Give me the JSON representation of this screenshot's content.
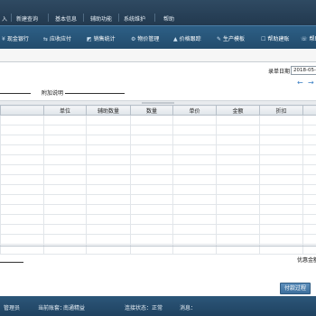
{
  "menubar": {
    "items": [
      "入",
      "新建查询",
      "基本信息",
      "辅助功能",
      "系统维护",
      "帮助"
    ]
  },
  "toolbar": {
    "items": [
      {
        "icon": "yen-icon",
        "glyph": "¥",
        "label": "现金银行"
      },
      {
        "icon": "exchange-icon",
        "glyph": "⇆",
        "label": "应收应付"
      },
      {
        "icon": "chart-icon",
        "glyph": "◩",
        "label": "销售统计"
      },
      {
        "icon": "gear-icon",
        "glyph": "⚙",
        "label": "物价管理"
      },
      {
        "icon": "price-icon",
        "glyph": "▲",
        "label": "价格跟踪"
      },
      {
        "icon": "wrench-icon",
        "glyph": "✎",
        "label": "生产模板"
      },
      {
        "icon": "help-icon",
        "glyph": "☐",
        "label": "帮助建账"
      },
      {
        "icon": "phone-icon",
        "glyph": "☏",
        "label": "帮助"
      }
    ]
  },
  "form": {
    "date_label": "录单日期",
    "date_value": "2018-05-2",
    "note_label": "附加说明",
    "prev_arrow": "←",
    "next_arrow": "→"
  },
  "table": {
    "headers": [
      "",
      "单位",
      "辅助数量",
      "数量",
      "单价",
      "金额",
      "折扣",
      ""
    ]
  },
  "footer": {
    "discount_label": "优惠金额",
    "process_button": "付款过程"
  },
  "status": {
    "operator": "管理员",
    "account_label": "当前账套：",
    "account_value": "南通精益",
    "connection": "连接状态：正常",
    "message": "消息："
  },
  "colors": {
    "menubar": "#22394f",
    "toolbar": "#2d5f86",
    "statusbar": "#1f4260",
    "accent": "#3b7fc4"
  }
}
